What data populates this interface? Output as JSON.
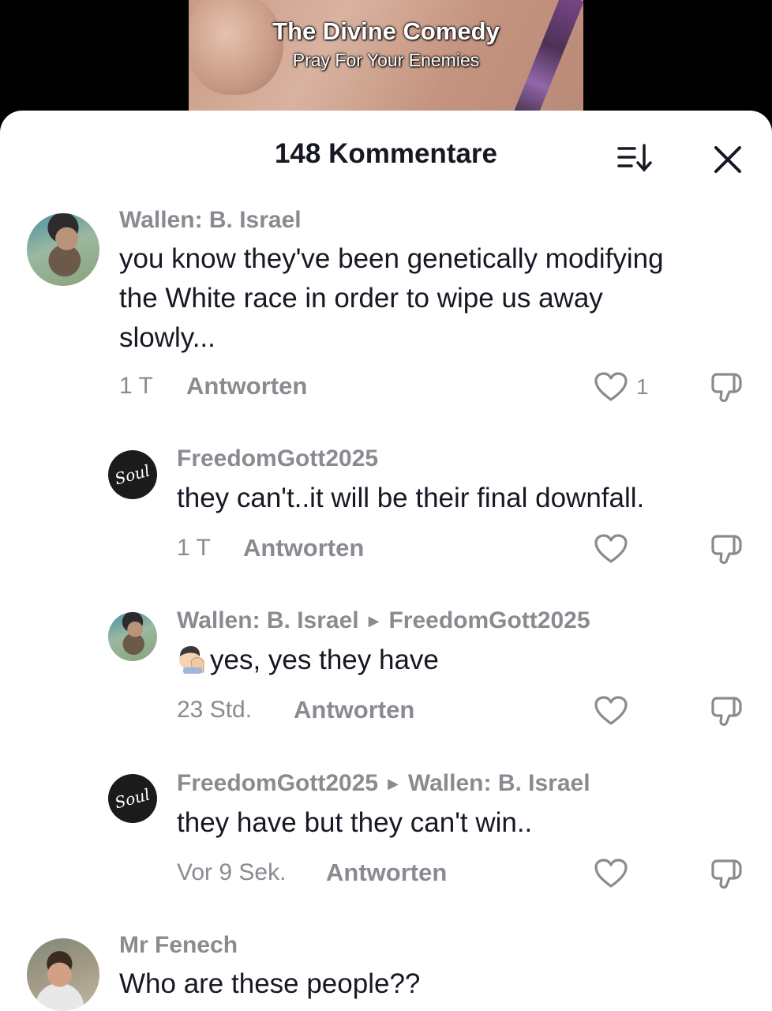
{
  "video": {
    "title": "The Divine Comedy",
    "subtitle": "Pray For Your Enemies"
  },
  "sheet": {
    "title": "148 Kommentare",
    "sort_icon": "sort-icon",
    "close_icon": "close-icon"
  },
  "comments": [
    {
      "username": "Wallen: B. Israel",
      "text_lines": [
        "you know they've been genetically modifying",
        "the White race in order to wipe us away",
        "slowly..."
      ],
      "time": "1 T",
      "reply_label": "Antworten",
      "likes": "1",
      "avatar": "bearded-man-photo"
    },
    {
      "username": "FreedomGott2025",
      "text": "they can't..it will be their final downfall.",
      "time": "1 T",
      "reply_label": "Antworten",
      "avatar": "soul-logo"
    },
    {
      "username": "Wallen: B. Israel",
      "reply_to": "FreedomGott2025",
      "emoji": "face-palm-emoji",
      "text": "yes, yes they have",
      "time": "23 Std.",
      "reply_label": "Antworten",
      "avatar": "bearded-man-photo"
    },
    {
      "username": "FreedomGott2025",
      "reply_to": "Wallen: B. Israel",
      "text": "they have but they can't win..",
      "time": "Vor 9 Sek.",
      "reply_label": "Antworten",
      "avatar": "soul-logo"
    },
    {
      "username": "Mr Fenech",
      "text": "Who are these people??",
      "avatar": "smiling-man-photo"
    }
  ],
  "avatar_logo_text": "Soul"
}
